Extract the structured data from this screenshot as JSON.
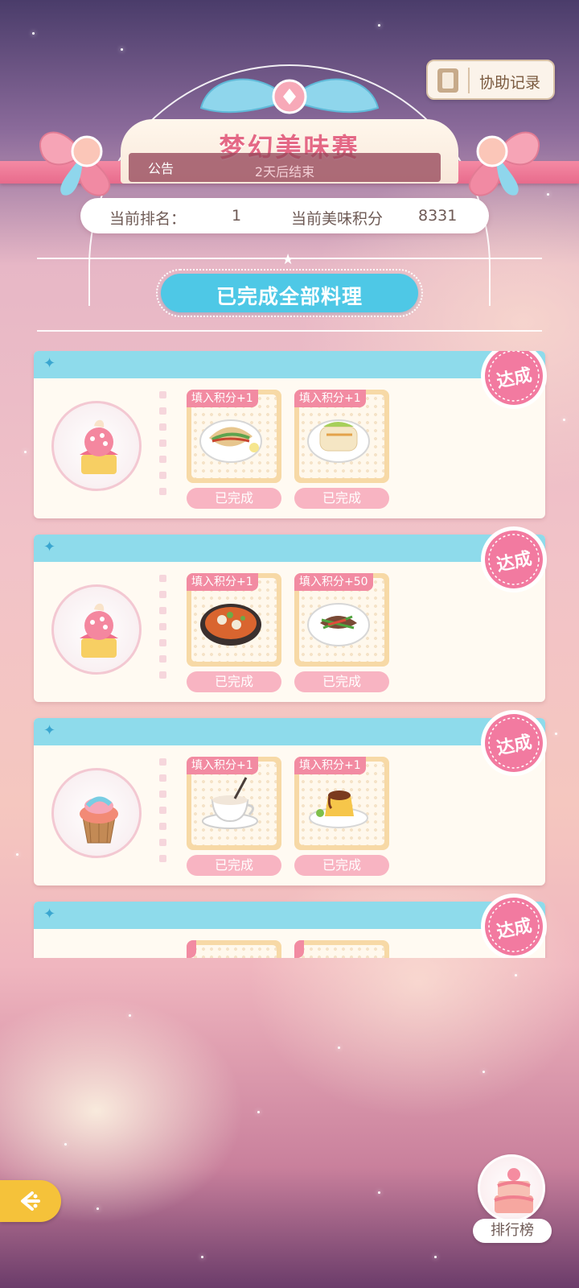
{
  "header": {
    "title": "梦幻美味赛",
    "notice_label": "公告",
    "countdown": "2天后结束",
    "help_button": "协助记录"
  },
  "status": {
    "rank_label": "当前排名：",
    "rank_value": "1",
    "score_label": "当前美味积分",
    "score_value": "8331"
  },
  "completion_banner": "已完成全部料理",
  "cards": [
    {
      "achieved": "达成",
      "dishes": [
        {
          "tag": "填入积分+1",
          "status": "已完成"
        },
        {
          "tag": "填入积分+1",
          "status": "已完成"
        }
      ]
    },
    {
      "achieved": "达成",
      "dishes": [
        {
          "tag": "填入积分+1",
          "status": "已完成"
        },
        {
          "tag": "填入积分+50",
          "status": "已完成"
        }
      ]
    },
    {
      "achieved": "达成",
      "dishes": [
        {
          "tag": "填入积分+1",
          "status": "已完成"
        },
        {
          "tag": "填入积分+1",
          "status": "已完成"
        }
      ]
    },
    {
      "achieved": "达成",
      "dishes": [
        {
          "tag": "",
          "status": ""
        },
        {
          "tag": "",
          "status": ""
        }
      ]
    }
  ],
  "leaderboard_button": "排行榜",
  "colors": {
    "accent_pink": "#f28ba2",
    "card_header_blue": "#8edbeb",
    "banner_blue": "#4ec8e6",
    "back_button_yellow": "#f5c23a"
  },
  "icons": {
    "help": "notebook-icon",
    "back": "back-arrow-icon",
    "achieved": "achieved-badge-icon"
  }
}
